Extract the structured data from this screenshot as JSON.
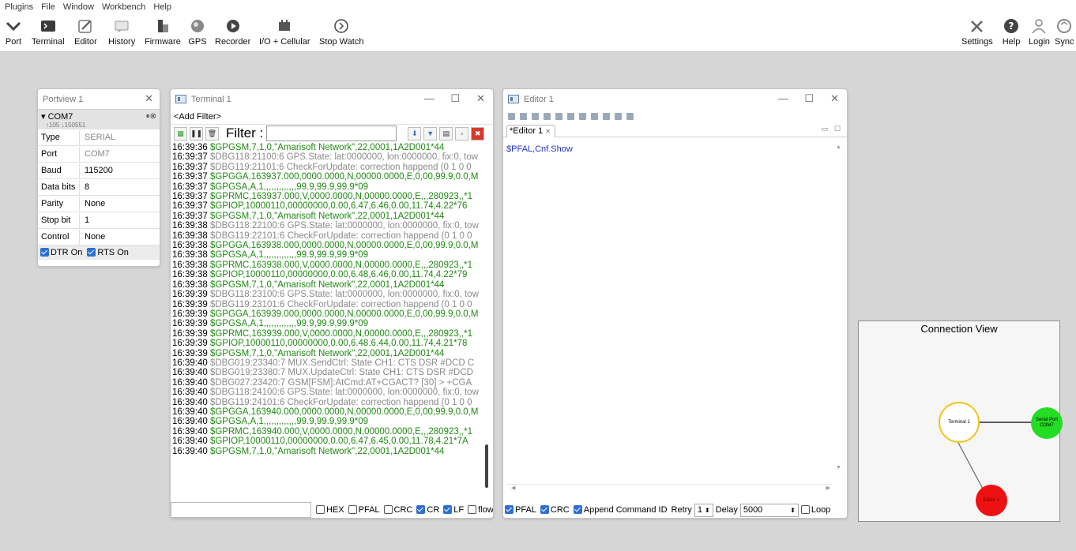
{
  "menu": [
    "Plugins",
    "File",
    "Window",
    "Workbench",
    "Help"
  ],
  "toolbar": {
    "left": [
      {
        "label": "Port",
        "icon": "port-icon"
      },
      {
        "label": "Terminal",
        "icon": "terminal-icon"
      },
      {
        "label": "Editor",
        "icon": "editor-icon"
      },
      {
        "label": "History",
        "icon": "history-icon"
      },
      {
        "label": "Firmware",
        "icon": "firmware-icon"
      },
      {
        "label": "GPS",
        "icon": "gps-icon"
      },
      {
        "label": "Recorder",
        "icon": "recorder-icon"
      },
      {
        "label": "I/O + Cellular",
        "icon": "io-cellular-icon"
      },
      {
        "label": "Stop Watch",
        "icon": "stopwatch-icon"
      }
    ],
    "right": [
      {
        "label": "Settings",
        "icon": "settings-icon"
      },
      {
        "label": "Help",
        "icon": "help-icon"
      },
      {
        "label": "Login",
        "icon": "login-icon"
      },
      {
        "label": "Sync",
        "icon": "sync-icon"
      }
    ]
  },
  "portview": {
    "title": "Portview 1",
    "port": "COM7",
    "stats": "↑105 ↓150551",
    "rows": [
      {
        "key": "Type",
        "value": "SERIAL"
      },
      {
        "key": "Port",
        "value": "COM7"
      },
      {
        "key": "Baud",
        "value": "115200"
      },
      {
        "key": "Data bits",
        "value": "8"
      },
      {
        "key": "Parity",
        "value": "None"
      },
      {
        "key": "Stop bit",
        "value": "1"
      },
      {
        "key": "Control",
        "value": "None"
      }
    ],
    "dtr": "DTR On",
    "rts": "RTS On"
  },
  "terminal": {
    "title": "Terminal 1",
    "add_filter": "<Add Filter>",
    "filter_label": "Filter :",
    "options": {
      "hex": "HEX",
      "pfal": "PFAL",
      "crc": "CRC",
      "cr": "CR",
      "lf": "LF",
      "flow": "flow"
    },
    "log": [
      {
        "c": "g",
        "time": "16:39:36",
        "text": "$GPGSM,7,1,0,\"Amarisoft Network\",22,0001,1A2D001*44"
      },
      {
        "c": "d",
        "time": "16:39:37",
        "text": "$DBG118:21100:6 GPS.State: lat:0000000, lon:0000000, fix:0, tow"
      },
      {
        "c": "d",
        "time": "16:39:37",
        "text": "$DBG119:21101:6 CheckForUpdate: correction happend (0 1 0 0"
      },
      {
        "c": "g",
        "time": "16:39:37",
        "text": "$GPGGA,163937.000,0000.0000,N,00000.0000,E,0,00,99.9,0.0,M"
      },
      {
        "c": "g",
        "time": "16:39:37",
        "text": "$GPGSA,A,1,,,,,,,,,,,,,99.9,99.9,99.9*09"
      },
      {
        "c": "g",
        "time": "16:39:37",
        "text": "$GPRMC,163937.000,V,0000.0000,N,00000.0000,E,,,280923,,*1"
      },
      {
        "c": "g",
        "time": "16:39:37",
        "text": "$GPIOP,10000110,00000000,0.00,6.47,6.46,0.00,11.74,4.22*76"
      },
      {
        "c": "g",
        "time": "16:39:37",
        "text": "$GPGSM,7,1,0,\"Amarisoft Network\",22,0001,1A2D001*44"
      },
      {
        "c": "d",
        "time": "16:39:38",
        "text": "$DBG118:22100:6 GPS.State: lat:0000000, lon:0000000, fix:0, tow"
      },
      {
        "c": "d",
        "time": "16:39:38",
        "text": "$DBG119:22101:6 CheckForUpdate: correction happend (0 1 0 0"
      },
      {
        "c": "g",
        "time": "16:39:38",
        "text": "$GPGGA,163938.000,0000.0000,N,00000.0000,E,0,00,99.9,0.0,M"
      },
      {
        "c": "g",
        "time": "16:39:38",
        "text": "$GPGSA,A,1,,,,,,,,,,,,,99.9,99.9,99.9*09"
      },
      {
        "c": "g",
        "time": "16:39:38",
        "text": "$GPRMC,163938.000,V,0000.0000,N,00000.0000,E,,,280923,,*1"
      },
      {
        "c": "g",
        "time": "16:39:38",
        "text": "$GPIOP,10000110,00000000,0.00,6.48,6.46,0.00,11.74,4.22*79"
      },
      {
        "c": "g",
        "time": "16:39:38",
        "text": "$GPGSM,7,1,0,\"Amarisoft Network\",22,0001,1A2D001*44"
      },
      {
        "c": "d",
        "time": "16:39:39",
        "text": "$DBG118:23100:6 GPS.State: lat:0000000, lon:0000000, fix:0, tow"
      },
      {
        "c": "d",
        "time": "16:39:39",
        "text": "$DBG119:23101:6 CheckForUpdate: correction happend (0 1 0 0"
      },
      {
        "c": "g",
        "time": "16:39:39",
        "text": "$GPGGA,163939.000,0000.0000,N,00000.0000,E,0,00,99.9,0.0,M"
      },
      {
        "c": "g",
        "time": "16:39:39",
        "text": "$GPGSA,A,1,,,,,,,,,,,,,99.9,99.9,99.9*09"
      },
      {
        "c": "g",
        "time": "16:39:39",
        "text": "$GPRMC,163939.000,V,0000.0000,N,00000.0000,E,,,280923,,*1"
      },
      {
        "c": "g",
        "time": "16:39:39",
        "text": "$GPIOP,10000110,00000000,0.00,6.48,6.44,0.00,11.74,4.21*78"
      },
      {
        "c": "g",
        "time": "16:39:39",
        "text": "$GPGSM,7,1,0,\"Amarisoft Network\",22,0001,1A2D001*44"
      },
      {
        "c": "d",
        "time": "16:39:40",
        "text": "$DBG019:23340:7 MUX.SendCtrl: State CH1: CTS DSR #DCD C"
      },
      {
        "c": "d",
        "time": "16:39:40",
        "text": "$DBG019:23380:7 MUX.UpdateCtrl: State CH1: CTS DSR #DCD"
      },
      {
        "c": "d",
        "time": "16:39:40",
        "text": "$DBG027:23420:7 GSM[FSM]:AtCmd:AT+CGACT? [30] > +CGA"
      },
      {
        "c": "d",
        "time": "16:39:40",
        "text": "$DBG118:24100:6 GPS.State: lat:0000000, lon:0000000, fix:0, tow"
      },
      {
        "c": "d",
        "time": "16:39:40",
        "text": "$DBG119:24101:6 CheckForUpdate: correction happend (0 1 0 0"
      },
      {
        "c": "g",
        "time": "16:39:40",
        "text": "$GPGGA,163940.000,0000.0000,N,00000.0000,E,0,00,99.9,0.0,M"
      },
      {
        "c": "g",
        "time": "16:39:40",
        "text": "$GPGSA,A,1,,,,,,,,,,,,,99.9,99.9,99.9*09"
      },
      {
        "c": "g",
        "time": "16:39:40",
        "text": "$GPRMC,163940.000,V,0000.0000,N,00000.0000,E,,,280923,,*1"
      },
      {
        "c": "g",
        "time": "16:39:40",
        "text": "$GPIOP,10000110,00000000,0.00,6.47,6.45,0.00,11.78,4.21*7A"
      },
      {
        "c": "g",
        "time": "16:39:40",
        "text": "$GPGSM,7,1,0,\"Amarisoft Network\",22,0001,1A2D001*44"
      }
    ]
  },
  "editor": {
    "title": "Editor 1",
    "tab": "*Editor 1",
    "content": "$PFAL,Cnf.Show",
    "pfal": "PFAL",
    "crc": "CRC",
    "append": "Append Command ID",
    "retry_label": "Retry",
    "retry_value": "1",
    "delay_label": "Delay",
    "delay_value": "5000",
    "loop": "Loop"
  },
  "connection_view": {
    "title": "Connection View",
    "nodes": {
      "terminal": "Terminal 1",
      "serial_1": "Serial Port",
      "serial_2": "COM7",
      "editor": "Editor 1"
    }
  },
  "colors": {
    "log_green": "#1f8a12",
    "log_gray": "#8a8a8a",
    "checkbox": "#2d6fd4",
    "node_green": "#22dd22",
    "node_red": "#ee1111",
    "node_yellow": "#f3c21b"
  }
}
